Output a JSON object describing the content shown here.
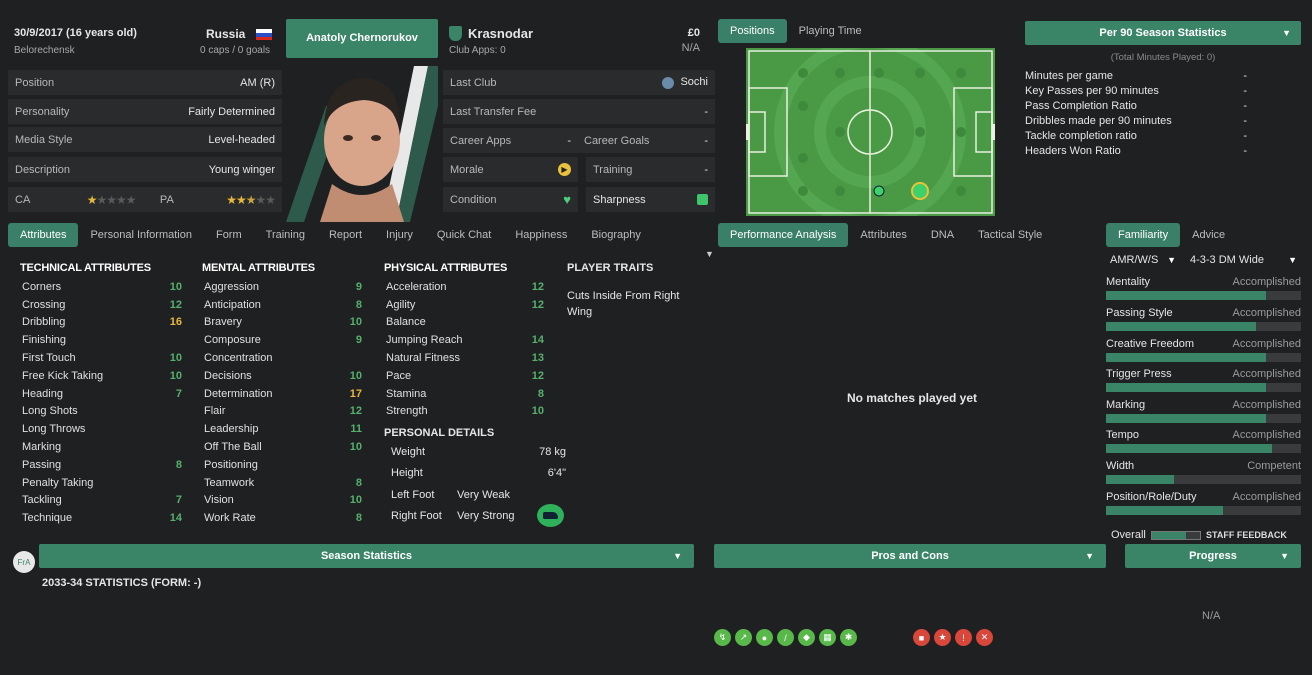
{
  "player": {
    "dob": "30/9/2017 (16 years old)",
    "birthplace": "Belorechensk",
    "nation": "Russia",
    "caps": "0 caps / 0 goals",
    "name": "Anatoly Chernorukov",
    "club": "Krasnodar",
    "club_apps": "Club Apps: 0",
    "value": "£0",
    "value_sub": "N/A"
  },
  "info_rows": [
    {
      "label": "Position",
      "value": "AM (R)"
    },
    {
      "label": "Personality",
      "value": "Fairly Determined"
    },
    {
      "label": "Media Style",
      "value": "Level-headed"
    },
    {
      "label": "Description",
      "value": "Young winger"
    }
  ],
  "ability": {
    "ca_label": "CA",
    "pa_label": "PA",
    "ca_stars": 1,
    "pa_stars": 2.5
  },
  "club_rows": {
    "last_club_label": "Last Club",
    "last_club": "Sochi",
    "transfer_label": "Last Transfer Fee",
    "transfer": "-",
    "apps_label": "Career Apps",
    "apps": "-",
    "goals_label": "Career Goals",
    "goals": "-",
    "morale_label": "Morale",
    "training_label": "Training",
    "training": "-",
    "condition_label": "Condition",
    "sharpness_label": "Sharpness"
  },
  "pitch_tabs": [
    "Positions",
    "Playing Time"
  ],
  "per90": {
    "title": "Per 90 Season Statistics",
    "sub": "(Total Minutes Played: 0)",
    "rows": [
      {
        "label": "Minutes per game",
        "value": "-"
      },
      {
        "label": "Key Passes per 90 minutes",
        "value": "-"
      },
      {
        "label": "Pass Completion Ratio",
        "value": "-"
      },
      {
        "label": "Dribbles made per 90 minutes",
        "value": "-"
      },
      {
        "label": "Tackle completion ratio",
        "value": "-"
      },
      {
        "label": "Headers Won Ratio",
        "value": "-"
      }
    ]
  },
  "left_tabs": [
    "Attributes",
    "Personal Information",
    "Form",
    "Training",
    "Report",
    "Injury",
    "Quick Chat",
    "Happiness",
    "Biography"
  ],
  "mid_tabs": [
    "Performance Analysis",
    "Attributes",
    "DNA",
    "Tactical Style"
  ],
  "right_tabs": [
    "Familiarity",
    "Advice"
  ],
  "technical": {
    "title": "TECHNICAL ATTRIBUTES",
    "items": [
      {
        "n": "Corners",
        "v": "10",
        "c": "c-g"
      },
      {
        "n": "Crossing",
        "v": "12",
        "c": "c-g"
      },
      {
        "n": "Dribbling",
        "v": "16",
        "c": "c-y"
      },
      {
        "n": "Finishing",
        "v": "",
        "c": ""
      },
      {
        "n": "First Touch",
        "v": "10",
        "c": "c-g"
      },
      {
        "n": "Free Kick Taking",
        "v": "10",
        "c": "c-g"
      },
      {
        "n": "Heading",
        "v": "7",
        "c": "c-g"
      },
      {
        "n": "Long Shots",
        "v": "",
        "c": ""
      },
      {
        "n": "Long Throws",
        "v": "",
        "c": ""
      },
      {
        "n": "Marking",
        "v": "",
        "c": ""
      },
      {
        "n": "Passing",
        "v": "8",
        "c": "c-g"
      },
      {
        "n": "Penalty Taking",
        "v": "",
        "c": ""
      },
      {
        "n": "Tackling",
        "v": "7",
        "c": "c-g"
      },
      {
        "n": "Technique",
        "v": "14",
        "c": "c-g"
      }
    ]
  },
  "mental": {
    "title": "MENTAL ATTRIBUTES",
    "items": [
      {
        "n": "Aggression",
        "v": "9",
        "c": "c-g"
      },
      {
        "n": "Anticipation",
        "v": "8",
        "c": "c-g"
      },
      {
        "n": "Bravery",
        "v": "10",
        "c": "c-g"
      },
      {
        "n": "Composure",
        "v": "9",
        "c": "c-g"
      },
      {
        "n": "Concentration",
        "v": "",
        "c": ""
      },
      {
        "n": "Decisions",
        "v": "10",
        "c": "c-g"
      },
      {
        "n": "Determination",
        "v": "17",
        "c": "c-y"
      },
      {
        "n": "Flair",
        "v": "12",
        "c": "c-g"
      },
      {
        "n": "Leadership",
        "v": "11",
        "c": "c-g"
      },
      {
        "n": "Off The Ball",
        "v": "10",
        "c": "c-g"
      },
      {
        "n": "Positioning",
        "v": "",
        "c": ""
      },
      {
        "n": "Teamwork",
        "v": "8",
        "c": "c-g"
      },
      {
        "n": "Vision",
        "v": "10",
        "c": "c-g"
      },
      {
        "n": "Work Rate",
        "v": "8",
        "c": "c-g"
      }
    ]
  },
  "physical": {
    "title": "PHYSICAL ATTRIBUTES",
    "items": [
      {
        "n": "Acceleration",
        "v": "12",
        "c": "c-g"
      },
      {
        "n": "Agility",
        "v": "12",
        "c": "c-g"
      },
      {
        "n": "Balance",
        "v": "",
        "c": ""
      },
      {
        "n": "Jumping Reach",
        "v": "14",
        "c": "c-g"
      },
      {
        "n": "Natural Fitness",
        "v": "13",
        "c": "c-g"
      },
      {
        "n": "Pace",
        "v": "12",
        "c": "c-g"
      },
      {
        "n": "Stamina",
        "v": "8",
        "c": "c-g"
      },
      {
        "n": "Strength",
        "v": "10",
        "c": "c-g"
      }
    ]
  },
  "personal": {
    "title": "PERSONAL DETAILS",
    "weight_label": "Weight",
    "weight": "78 kg",
    "height_label": "Height",
    "height": "6'4\"",
    "lf_label": "Left Foot",
    "lf": "Very Weak",
    "rf_label": "Right Foot",
    "rf": "Very Strong"
  },
  "traits": {
    "title": "PLAYER TRAITS",
    "text": "Cuts Inside From Right Wing"
  },
  "no_matches": "No matches played yet",
  "familiarity": {
    "selects": [
      "AMR/W/S",
      "4-3-3 DM Wide"
    ],
    "rows": [
      {
        "label": "Mentality",
        "status": "Accomplished",
        "level": 0.82
      },
      {
        "label": "Passing Style",
        "status": "Accomplished",
        "level": 0.77
      },
      {
        "label": "Creative Freedom",
        "status": "Accomplished",
        "level": 0.82
      },
      {
        "label": "Trigger Press",
        "status": "Accomplished",
        "level": 0.82
      },
      {
        "label": "Marking",
        "status": "Accomplished",
        "level": 0.82
      },
      {
        "label": "Tempo",
        "status": "Accomplished",
        "level": 0.85
      },
      {
        "label": "Width",
        "status": "Competent",
        "level": 0.35
      },
      {
        "label": "Position/Role/Duty",
        "status": "Accomplished",
        "level": 0.6
      }
    ],
    "overall_label": "Overall",
    "staff": "STAFF FEEDBACK"
  },
  "bottom": {
    "fra": "FrA",
    "season": "Season Statistics",
    "stats_title": "2033-34 STATISTICS (FORM: -)",
    "pros": "Pros and Cons",
    "progress": "Progress",
    "progress_value": "N/A"
  },
  "colors": {
    "accent": "#3a8468",
    "yellow": "#e8b83c",
    "green": "#56b06c",
    "red": "#d9463a"
  }
}
